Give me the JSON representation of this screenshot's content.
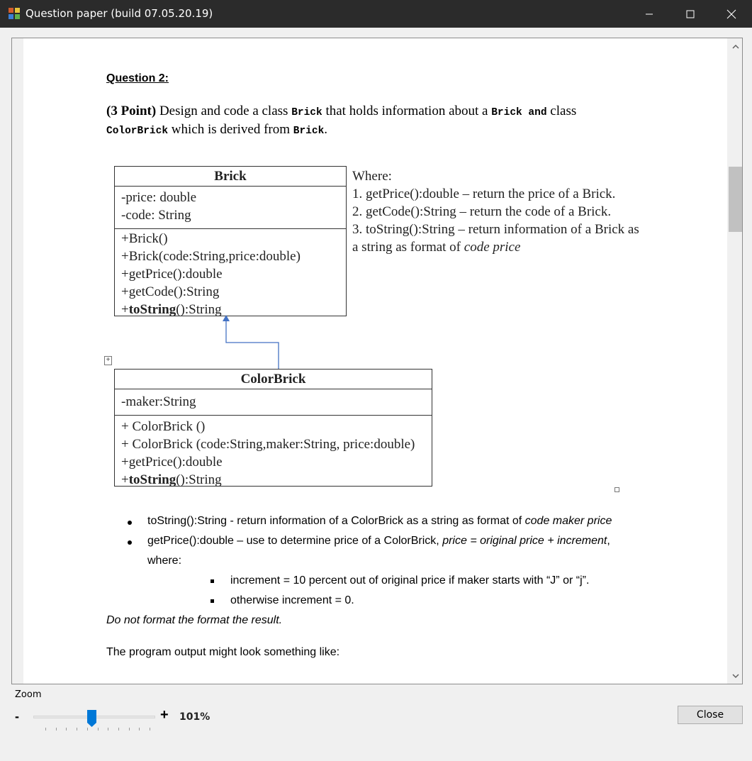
{
  "window": {
    "title": "Question paper (build 07.05.20.19)",
    "controls": [
      "minimize-icon",
      "maximize-icon",
      "close-icon"
    ]
  },
  "document": {
    "question_title": "Question 2:",
    "intro": {
      "points": "(3 Point)",
      "t1": " Design and code a class ",
      "brick_code": "Brick",
      "t2": " that holds information about a ",
      "brick_and": "Brick and",
      "t3": " class",
      "colorbrick_code": "ColorBrick",
      "t4": " which is derived from ",
      "brick_code2": "Brick",
      "t5": "."
    },
    "brick_uml": {
      "name": "Brick",
      "attributes": [
        "-price: double",
        "-code: String"
      ],
      "operations": [
        "+Brick()",
        "+Brick(code:String,price:double)",
        "+getPrice():double",
        "+getCode():String"
      ],
      "last_op_prefix": "+",
      "last_op_bold": "toString",
      "last_op_suffix": "():String"
    },
    "where": {
      "line0": "Where:",
      "line1": "1. getPrice():double – return the price of a Brick.",
      "line2": "2. getCode():String – return the code of a Brick.",
      "line3": "3. toString():String – return information of a Brick as",
      "line4_prefix": "a string as format of ",
      "line4_italic": "code price"
    },
    "colorbrick_uml": {
      "name": "ColorBrick",
      "attributes": [
        "-maker:String"
      ],
      "operations": [
        "+ ColorBrick ()",
        "+ ColorBrick (code:String,maker:String, price:double)",
        "+getPrice():double"
      ],
      "last_op_prefix": "+",
      "last_op_bold": "toString",
      "last_op_suffix": "():String"
    },
    "bullets": {
      "b1_prefix": "toString():String - return information of a ColorBrick as a string as format of ",
      "b1_italic": "code maker price",
      "b2_prefix": "getPrice():double – use to determine price of a ColorBrick, ",
      "b2_italic": "price = original price + increment",
      "b2_suffix": ",",
      "b2_cont": "where:",
      "s1": "increment = 10 percent out of original price if maker starts with “J” or “j”.",
      "s2": "otherwise increment = 0.",
      "note": "Do not format the format the result.",
      "output": "The program output might look something like:"
    }
  },
  "controls": {
    "zoom_label": "Zoom",
    "zoom_minus": "-",
    "zoom_plus": "+",
    "zoom_percent": "101%",
    "zoom_level": 0.5,
    "close_label": "Close"
  },
  "colors": {
    "title_bar": "#2b2b2b",
    "slider_thumb": "#0078d7",
    "inheritance_arrow": "#4472c4"
  }
}
